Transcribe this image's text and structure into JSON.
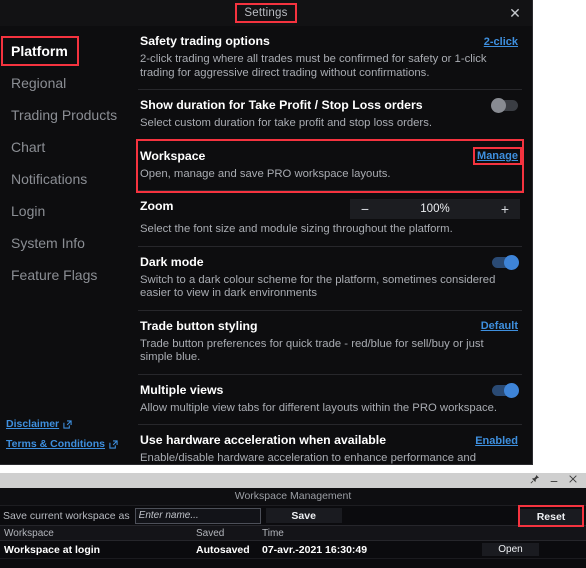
{
  "settings_window": {
    "title": "Settings",
    "close_icon": "close-icon",
    "sidebar": {
      "items": [
        {
          "label": "Platform",
          "active": true
        },
        {
          "label": "Regional",
          "active": false
        },
        {
          "label": "Trading Products",
          "active": false
        },
        {
          "label": "Chart",
          "active": false
        },
        {
          "label": "Notifications",
          "active": false
        },
        {
          "label": "Login",
          "active": false
        },
        {
          "label": "System Info",
          "active": false
        },
        {
          "label": "Feature Flags",
          "active": false
        }
      ],
      "links": [
        {
          "label": "Disclaimer",
          "icon": "external-link-icon"
        },
        {
          "label": "Terms & Conditions",
          "icon": "external-link-icon"
        }
      ]
    },
    "rows": [
      {
        "title": "Safety trading options",
        "action": "2-click",
        "desc": "2-click trading where all trades must be confirmed for safety or 1-click trading for aggressive direct trading without confirmations."
      },
      {
        "title": "Show duration for Take Profit / Stop Loss orders",
        "toggle": "off",
        "desc": "Select custom duration for take profit and stop loss orders."
      },
      {
        "title": "Workspace",
        "action": "Manage",
        "desc": "Open, manage and save PRO workspace layouts."
      },
      {
        "title": "Zoom",
        "zoom_value": "100%",
        "minus": "−",
        "plus": "+",
        "desc": "Select the font size and module sizing throughout the platform."
      },
      {
        "title": "Dark mode",
        "toggle": "on",
        "desc": "Switch to a dark colour scheme for the platform, sometimes considered easier to view in dark environments"
      },
      {
        "title": "Trade button styling",
        "action": "Default",
        "desc": "Trade button preferences for quick trade - red/blue for sell/buy or just simple blue."
      },
      {
        "title": "Multiple views",
        "toggle": "on",
        "desc": "Allow multiple view tabs for different layouts within the PRO workspace."
      },
      {
        "title": "Use hardware acceleration when available",
        "action": "Enabled",
        "desc": "Enable/disable hardware acceleration to enhance performance and charting. Disable this setting if you experience chart display issues."
      }
    ]
  },
  "workspace_window": {
    "chrome": {
      "pin_icon": "pin-icon",
      "minimize_icon": "minimize-icon",
      "close_icon": "close-icon"
    },
    "title": "Workspace Management",
    "save_label": "Save current workspace as",
    "input_placeholder": "Enter name...",
    "input_value": "",
    "save_button": "Save",
    "reset_button": "Reset",
    "table": {
      "headers": [
        "Workspace",
        "Saved",
        "Time",
        ""
      ],
      "rows": [
        {
          "workspace": "Workspace at login",
          "saved": "Autosaved",
          "time": "07-avr.-2021 16:30:49",
          "action": "Open"
        }
      ]
    }
  },
  "colors": {
    "accent_link": "#3e8fde",
    "highlight_red": "#f5333f",
    "toggle_on": "#3e84d8",
    "panel_bg": "#0d0d0f"
  }
}
